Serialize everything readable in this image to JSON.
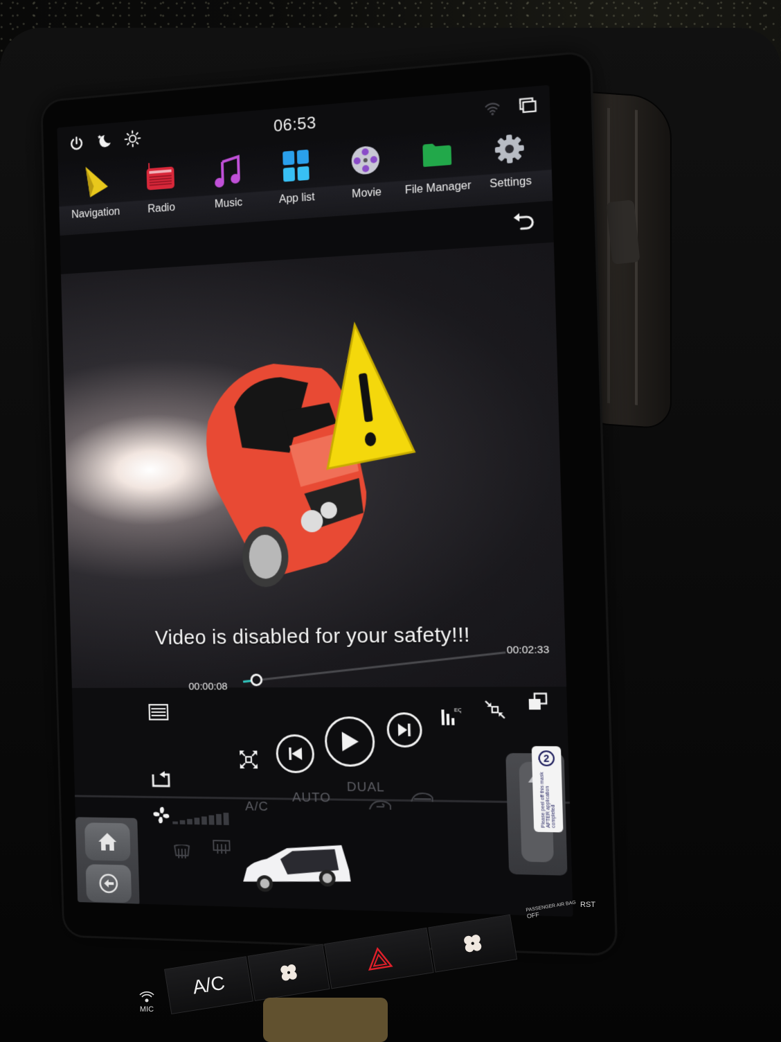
{
  "status_bar": {
    "time": "06:53",
    "icons": [
      "power-icon",
      "night-mode-icon",
      "brightness-icon",
      "wifi-icon",
      "recent-apps-icon"
    ]
  },
  "dock": {
    "items": [
      {
        "label": "Navigation",
        "icon": "navigation-icon",
        "color": "#e8c81c"
      },
      {
        "label": "Radio",
        "icon": "radio-icon",
        "color": "#d8283a"
      },
      {
        "label": "Music",
        "icon": "music-icon",
        "color": "#c050d8"
      },
      {
        "label": "App list",
        "icon": "app-list-icon",
        "color": "#2aa0ec"
      },
      {
        "label": "Movie",
        "icon": "movie-icon",
        "color": "#8a4cc8"
      },
      {
        "label": "File Manager",
        "icon": "folder-icon",
        "color": "#22a84a"
      },
      {
        "label": "Settings",
        "icon": "gear-icon",
        "color": "#b8bcc4"
      }
    ]
  },
  "player": {
    "warning_message": "Video is disabled for your safety!!!",
    "current_time": "00:00:08",
    "total_time": "00:02:33",
    "progress_fraction": 0.052,
    "progress_color": "#2fc8c0",
    "eq_label": "EQ",
    "controls": [
      "playlist-icon",
      "previous-icon",
      "play-icon",
      "next-icon",
      "equalizer-icon",
      "shrink-icon",
      "window-mode-icon",
      "repeat-icon",
      "fullscreen-icon"
    ]
  },
  "climate": {
    "ac_label": "A/C",
    "auto_label": "AUTO",
    "dual_label": "DUAL",
    "fan_level_fraction": 0
  },
  "side_keys": {
    "home": "home-icon",
    "back": "back-icon"
  },
  "sticker": {
    "text": "Please peel off this mask AFTER application completed",
    "number": "2"
  },
  "physical_panel": {
    "ac_label": "A/C",
    "mic_label": "MIC",
    "rst_label": "RST",
    "airbag_label": "PASSENGER AIR BAG",
    "airbag_status": "OFF",
    "hazard_color": "#e0202a"
  }
}
